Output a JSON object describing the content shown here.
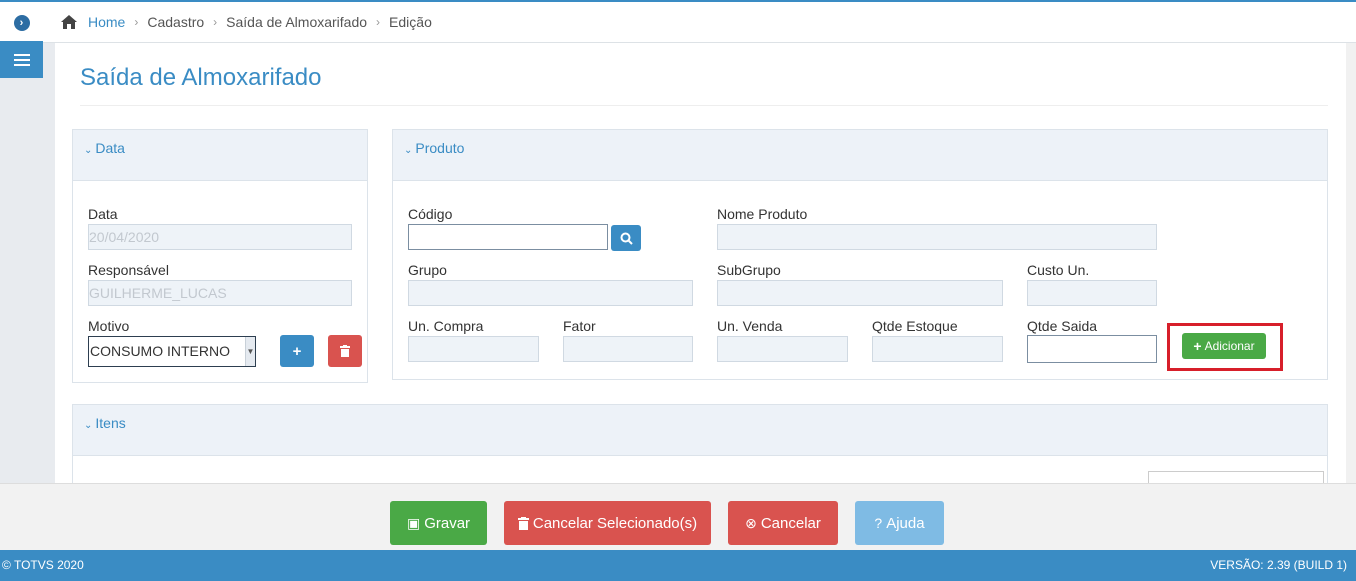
{
  "breadcrumb": {
    "home": "Home",
    "items": [
      "Cadastro",
      "Saída de Almoxarifado",
      "Edição"
    ]
  },
  "page": {
    "title": "Saída de Almoxarifado"
  },
  "data_panel": {
    "header": "Data",
    "data_label": "Data",
    "data_value": "20/04/2020",
    "responsavel_label": "Responsável",
    "responsavel_value": "GUILHERME_LUCAS",
    "motivo_label": "Motivo",
    "motivo_value": "CONSUMO INTERNO"
  },
  "produto_panel": {
    "header": "Produto",
    "codigo_label": "Código",
    "codigo_value": "",
    "nome_label": "Nome Produto",
    "nome_value": "",
    "grupo_label": "Grupo",
    "subgrupo_label": "SubGrupo",
    "custo_label": "Custo Un.",
    "un_compra_label": "Un. Compra",
    "fator_label": "Fator",
    "un_venda_label": "Un. Venda",
    "qtde_estoque_label": "Qtde Estoque",
    "qtde_saida_label": "Qtde Saida",
    "qtde_saida_value": "",
    "add_label": "Adicionar"
  },
  "itens_panel": {
    "header": "Itens"
  },
  "footer_buttons": {
    "gravar": "Gravar",
    "cancelar_sel": "Cancelar Selecionado(s)",
    "cancelar": "Cancelar",
    "ajuda": "Ajuda"
  },
  "status": {
    "copyright": "© TOTVS 2020",
    "version": "VERSÃO: 2.39 (BUILD 1)"
  },
  "colors": {
    "primary": "#3a8cc4",
    "success": "#4aa946",
    "danger": "#d9534f",
    "highlight": "#d71f2a",
    "help": "#7fbbe4"
  },
  "icons": [
    "chevron-right-circle-icon",
    "hamburger-menu-icon",
    "home-icon",
    "search-icon",
    "plus-icon",
    "trash-icon",
    "save-icon",
    "times-circle-icon",
    "question-circle-icon"
  ]
}
